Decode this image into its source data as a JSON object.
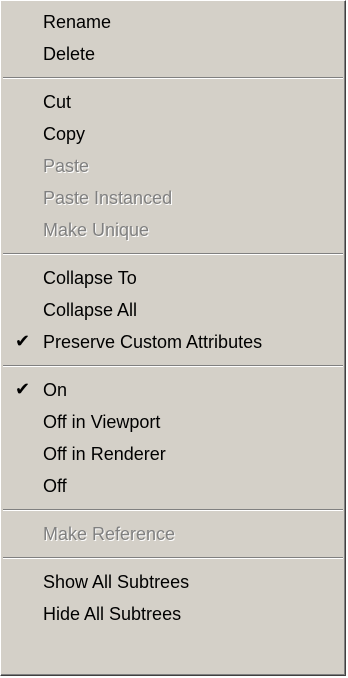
{
  "menu": {
    "items": [
      {
        "label": "Rename"
      },
      {
        "label": "Delete"
      },
      {
        "label": "Cut"
      },
      {
        "label": "Copy"
      },
      {
        "label": "Paste",
        "disabled": true
      },
      {
        "label": "Paste Instanced",
        "disabled": true
      },
      {
        "label": "Make Unique",
        "disabled": true
      },
      {
        "label": "Collapse To"
      },
      {
        "label": "Collapse All"
      },
      {
        "label": "Preserve Custom Attributes",
        "checked": true
      },
      {
        "label": "On",
        "checked": true
      },
      {
        "label": "Off in Viewport"
      },
      {
        "label": "Off in Renderer"
      },
      {
        "label": "Off"
      },
      {
        "label": "Make Reference",
        "disabled": true
      },
      {
        "label": "Show All Subtrees"
      },
      {
        "label": "Hide All Subtrees"
      }
    ],
    "check_glyph": "✔"
  },
  "colors": {
    "menu_background": "#d4d0c8",
    "text": "#000000",
    "disabled_text": "#808080",
    "separator_dark": "#808080",
    "separator_light": "#ffffff"
  }
}
